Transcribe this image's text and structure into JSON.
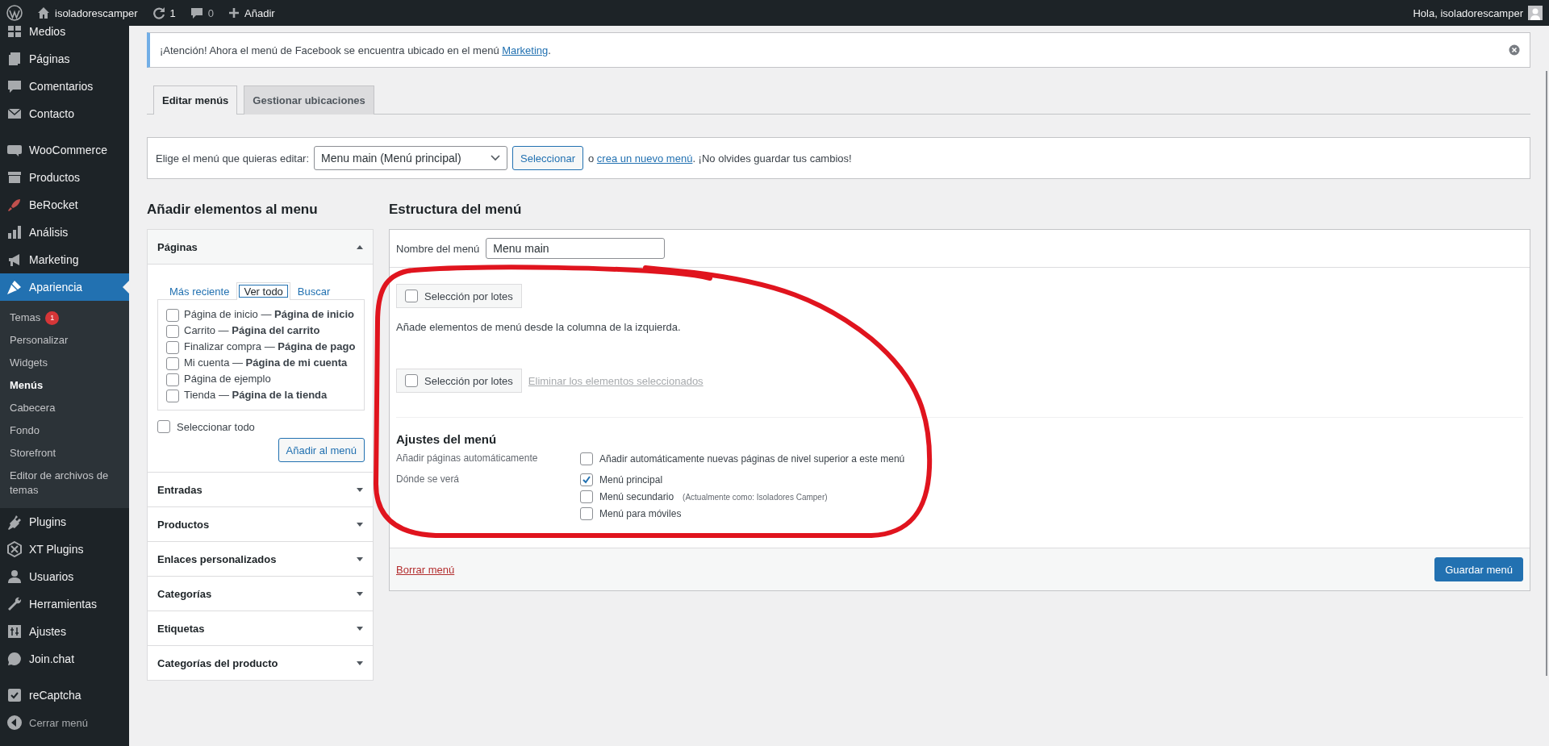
{
  "admin_bar": {
    "site": "isoladorescamper",
    "updates": "1",
    "comments": "0",
    "new": "Añadir",
    "greeting": "Hola, isoladorescamper"
  },
  "sidebar": {
    "groups": [
      [
        {
          "label": "Medios",
          "selected": false
        },
        {
          "label": "Páginas",
          "selected": false
        },
        {
          "label": "Comentarios",
          "selected": false
        },
        {
          "label": "Contacto",
          "selected": false
        }
      ],
      [
        {
          "label": "WooCommerce",
          "selected": false
        },
        {
          "label": "Productos",
          "selected": false
        },
        {
          "label": "BeRocket",
          "selected": false
        },
        {
          "label": "Análisis",
          "selected": false
        },
        {
          "label": "Marketing",
          "selected": false
        },
        {
          "label": "Apariencia",
          "selected": true,
          "children": [
            {
              "label": "Temas",
              "badge": "1",
              "selected": false
            },
            {
              "label": "Personalizar",
              "selected": false
            },
            {
              "label": "Widgets",
              "selected": false
            },
            {
              "label": "Menús",
              "selected": true
            },
            {
              "label": "Cabecera",
              "selected": false
            },
            {
              "label": "Fondo",
              "selected": false
            },
            {
              "label": "Storefront",
              "selected": false
            },
            {
              "label": "Editor de archivos de temas",
              "selected": false
            }
          ]
        },
        {
          "label": "Plugins",
          "selected": false
        },
        {
          "label": "XT Plugins",
          "selected": false
        },
        {
          "label": "Usuarios",
          "selected": false
        },
        {
          "label": "Herramientas",
          "selected": false
        },
        {
          "label": "Ajustes",
          "selected": false
        },
        {
          "label": "Join.chat",
          "selected": false
        }
      ],
      [
        {
          "label": "reCaptcha",
          "selected": false
        }
      ]
    ],
    "collapse": "Cerrar menú"
  },
  "notice": {
    "text": "¡Atención! Ahora el menú de Facebook se encuentra ubicado en el menú",
    "link": "Marketing",
    "end": "."
  },
  "tabs": [
    {
      "label": "Editar menús",
      "selected": true
    },
    {
      "label": "Gestionar ubicaciones",
      "selected": false
    }
  ],
  "menu_picker": {
    "label": "Elige el menú que quieras editar:",
    "value": "Menu main (Menú principal)",
    "button": "Seleccionar",
    "or": "o",
    "link": "crea un nuevo menú",
    "after": ". ¡No olvides guardar tus cambios!"
  },
  "add_items": {
    "title": "Añadir elementos al menu",
    "sections": [
      {
        "title": "Páginas",
        "expanded": true,
        "tabs": [
          {
            "label": "Más reciente",
            "selected": false
          },
          {
            "label": "Ver todo",
            "selected": true
          },
          {
            "label": "Buscar",
            "selected": false
          }
        ],
        "items": [
          {
            "label": "Página de inicio — **Página de inicio**",
            "checked": false
          },
          {
            "label": "Carrito — **Página del carrito**",
            "checked": false
          },
          {
            "label": "Finalizar compra — **Página de pago**",
            "checked": false
          },
          {
            "label": "Mi cuenta — **Página de mi cuenta**",
            "checked": false
          },
          {
            "label": "Página de ejemplo",
            "checked": false
          },
          {
            "label": "Tienda — **Página de la tienda**",
            "checked": false
          }
        ],
        "select_all": {
          "label": "Seleccionar todo",
          "checked": false
        },
        "button": "Añadir al menú"
      },
      {
        "title": "Entradas",
        "expanded": false
      },
      {
        "title": "Productos",
        "expanded": false
      },
      {
        "title": "Enlaces personalizados",
        "expanded": false
      },
      {
        "title": "Categorías",
        "expanded": false
      },
      {
        "title": "Etiquetas",
        "expanded": false
      },
      {
        "title": "Categorías del producto",
        "expanded": false
      }
    ]
  },
  "structure": {
    "title": "Estructura del menú",
    "name_label": "Nombre del menú",
    "name_value": "Menu main",
    "bulk_top": {
      "label": "Selección por lotes",
      "checked": false
    },
    "hint": "Añade elementos de menú desde la columna de la izquierda.",
    "bulk_bottom": {
      "label": "Selección por lotes",
      "checked": false
    },
    "delete_selected": {
      "label": "Eliminar los elementos seleccionados",
      "disabled": true
    },
    "settings": {
      "title": "Ajustes del menú",
      "rows": [
        {
          "label": "Añadir páginas automáticamente",
          "options": [
            {
              "label": "Añadir automáticamente nuevas páginas de nivel superior a este menú",
              "checked": false
            }
          ]
        },
        {
          "label": "Dónde se verá",
          "options": [
            {
              "label": "Menú principal",
              "checked": true
            },
            {
              "label": "Menú secundario",
              "note": "(Actualmente como: Isoladores Camper)",
              "checked": false
            },
            {
              "label": "Menú para móviles",
              "checked": false
            }
          ]
        }
      ]
    },
    "delete_menu": "Borrar menú",
    "save": "Guardar menú"
  }
}
